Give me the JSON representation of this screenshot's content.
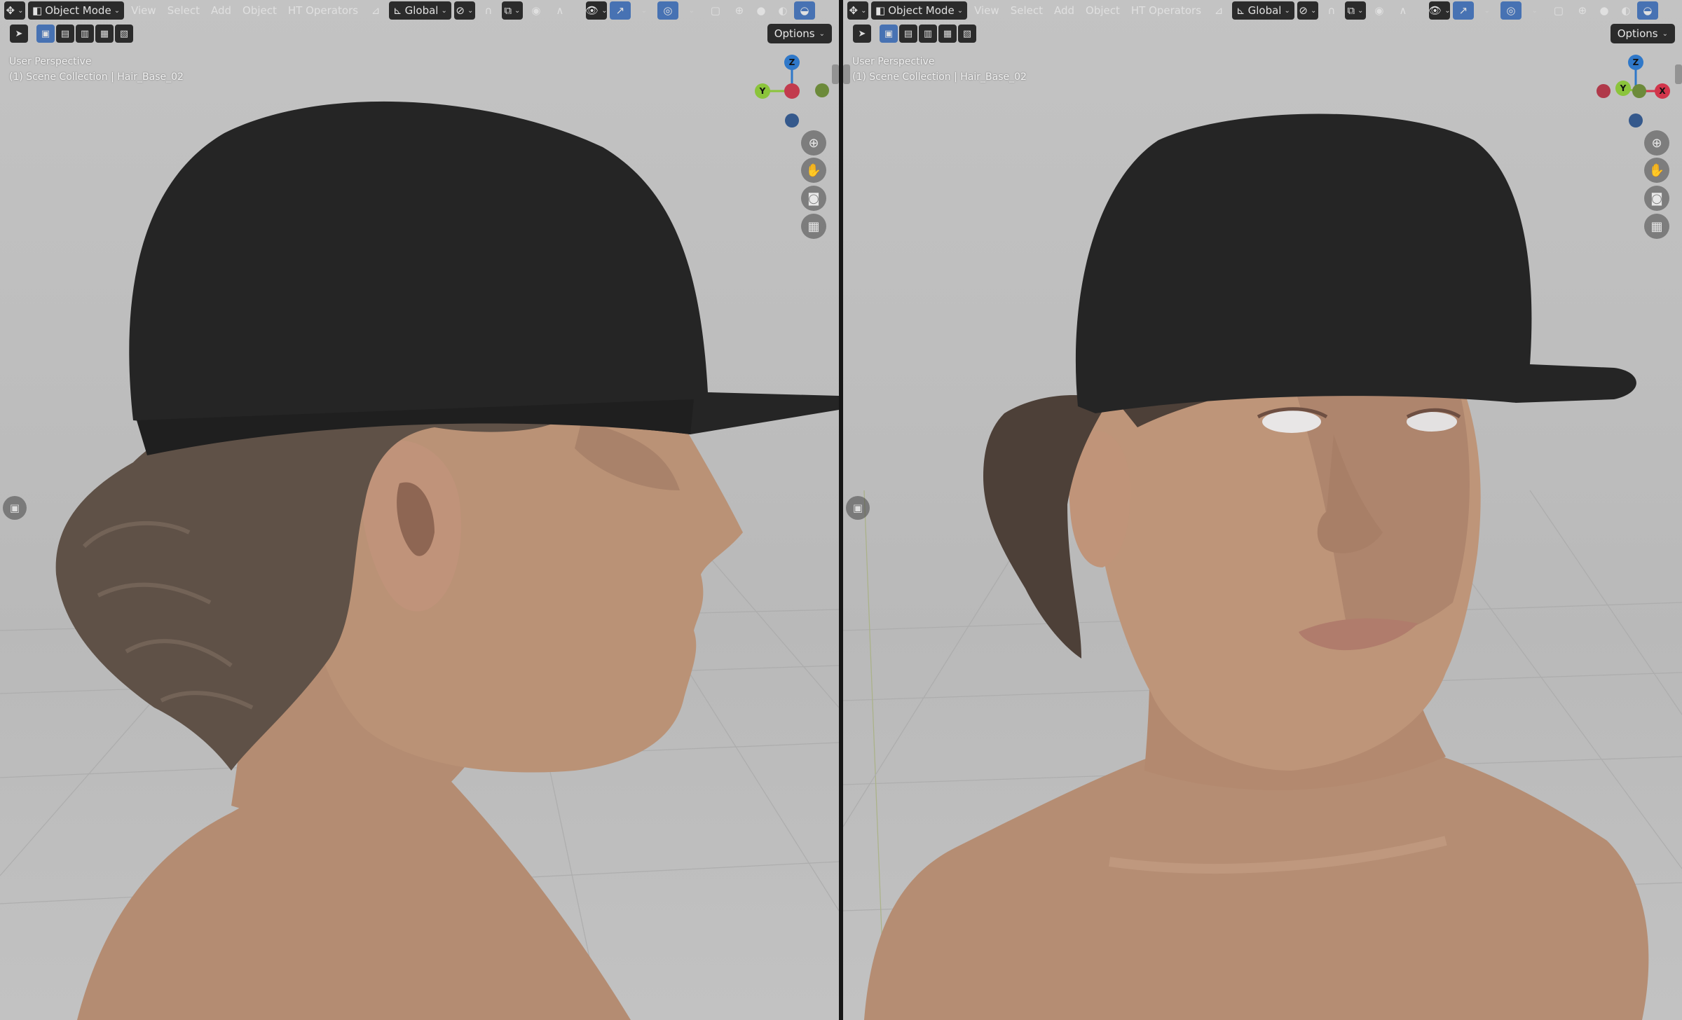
{
  "viewports": [
    {
      "id": "left",
      "header": {
        "mode": "Object Mode",
        "menus": [
          "View",
          "Select",
          "Add",
          "Object",
          "HT Operators"
        ],
        "orientation": "Global"
      },
      "options_label": "Options",
      "info": {
        "line1": "User Perspective",
        "line2": "(1) Scene Collection | Hair_Base_02"
      },
      "gizmo": {
        "z": "Z",
        "y": "Y"
      }
    },
    {
      "id": "right",
      "header": {
        "mode": "Object Mode",
        "menus": [
          "View",
          "Select",
          "Add",
          "Object",
          "HT Operators"
        ],
        "orientation": "Global"
      },
      "options_label": "Options",
      "info": {
        "line1": "User Perspective",
        "line2": "(1) Scene Collection | Hair_Base_02"
      },
      "gizmo": {
        "z": "Z",
        "y": "Y",
        "x": "X"
      }
    }
  ],
  "colors": {
    "axis_x": "#d2354b",
    "axis_y": "#8bc43b",
    "axis_z": "#2f78c9",
    "active_button": "#4772b3",
    "cap": "#252525",
    "skin": "#b18a6f",
    "hair": "#5d4f45"
  },
  "icons": {
    "editor_type": "editor-type-icon",
    "mode": "object-mode-icon",
    "transform_orientation": "orientation-icon",
    "pivot": "pivot-icon",
    "snap": "snap-icon",
    "proportional": "proportional-edit-icon",
    "visibility": "visibility-icon",
    "gizmo": "gizmo-toggle-icon",
    "overlay": "overlay-icon",
    "xray": "xray-icon",
    "shading": [
      "wireframe-shading-icon",
      "solid-shading-icon",
      "material-shading-icon",
      "rendered-shading-icon"
    ],
    "navigation": [
      "zoom-icon",
      "pan-hand-icon",
      "camera-icon",
      "grid-view-icon"
    ]
  }
}
